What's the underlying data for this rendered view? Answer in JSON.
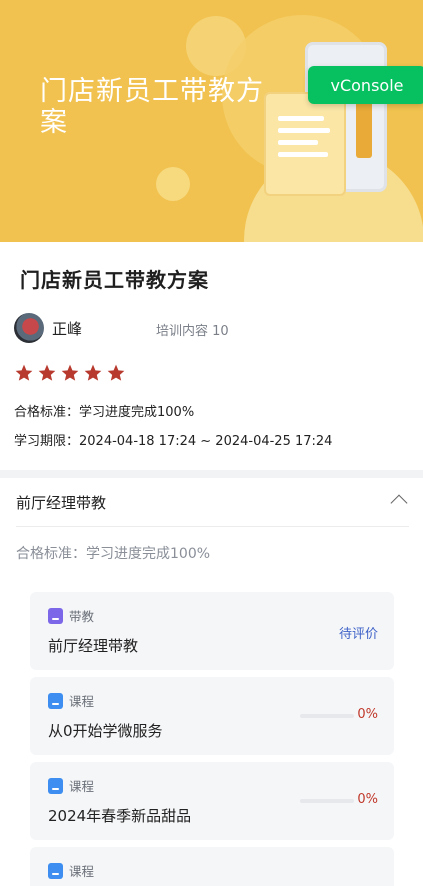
{
  "banner": {
    "title": "门店新员工带教方案",
    "vconsole_label": "vConsole"
  },
  "info": {
    "title": "门店新员工带教方案",
    "author": "正峰",
    "training_count": "培训内容 10",
    "rating": 5,
    "standard": "合格标准：学习进度完成100%",
    "period": "学习期限：2024-04-18 17:24 ~ 2024-04-25 17:24"
  },
  "section": {
    "title": "前厅经理带教",
    "standard": "合格标准：学习进度完成100%",
    "expanded": true
  },
  "items": [
    {
      "type_label": "带教",
      "icon": "teach-icon",
      "name": "前厅经理带教",
      "status": "待评价"
    },
    {
      "type_label": "课程",
      "icon": "course-icon",
      "name": "从0开始学微服务",
      "progress_text": "0%",
      "progress": 0
    },
    {
      "type_label": "课程",
      "icon": "course-icon",
      "name": "2024年春季新品甜品",
      "progress_text": "0%",
      "progress": 0
    },
    {
      "type_label": "课程",
      "icon": "course-icon"
    }
  ],
  "colors": {
    "banner": "#f1c24f",
    "star": "#b83a2e",
    "status_link": "#3f63c8",
    "progress": "#c0392b",
    "vconsole": "#07c160"
  }
}
